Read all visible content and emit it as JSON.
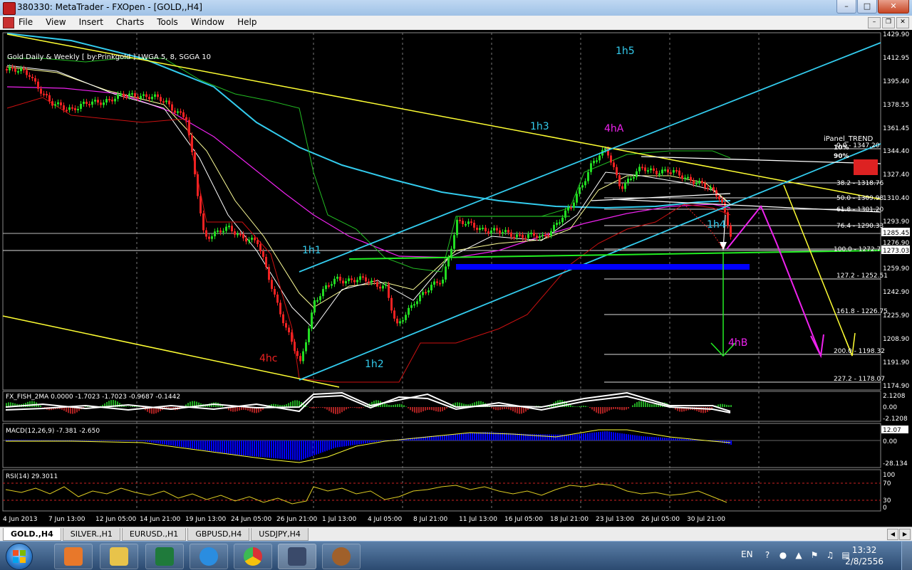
{
  "window": {
    "title": "380330: MetaTrader - FXOpen - [GOLD,,H4]"
  },
  "menu": {
    "items": [
      "File",
      "View",
      "Insert",
      "Charts",
      "Tools",
      "Window",
      "Help"
    ]
  },
  "chart": {
    "header": "Gold Daily & Weekly [ by:Prinkgold ] LWGA 5, 8, SGGA 10",
    "fish_label": "FX_FISH_2MA 0.0000 -1.7023 -1.7023 -0.9687 -0.1442",
    "macd_label": "MACD(12,26,9) -7.381 -2.650",
    "rsi_label": "RSI(14) 29.3011",
    "ipanel": "iPanel_TREND",
    "ipanel_rows": [
      "10%",
      "90%"
    ],
    "annotations": {
      "h1h1": "1h1",
      "h1h2": "1h2",
      "h1h3": "1h3",
      "h1h4": "1h4",
      "h1h5": "1h5",
      "h4a": "4hA",
      "h4b": "4hB",
      "h4c": "4hc"
    },
    "price_axis": [
      "1429.90",
      "1412.95",
      "1395.40",
      "1378.55",
      "1361.45",
      "1344.40",
      "1327.40",
      "1310.40",
      "1293.90",
      "1276.90",
      "1259.90",
      "1242.90",
      "1225.90",
      "1208.90",
      "1191.90",
      "1174.90"
    ],
    "price_tags": {
      "bid": "1285.45",
      "line": "1273.03"
    },
    "fib_labels": [
      "0.0 - 1347.20",
      "38.2 - 1318.76",
      "50.0 - 1309.98",
      "61.8 - 1301.20",
      "76.4 - 1290.33",
      "100.0 - 1272.76",
      "127.2 - 1252.51",
      "161.8 - 1226.75",
      "200.0 - 1198.32",
      "227.2 - 1178.07"
    ],
    "fish_axis": [
      "2.1208",
      "0.00",
      "-2.1208"
    ],
    "macd_axis": [
      "12.07",
      "0.00",
      "-28.134"
    ],
    "rsi_axis": [
      "100",
      "70",
      "30",
      "0"
    ],
    "time_axis": [
      "4 Jun 2013",
      "7 Jun 13:00",
      "12 Jun 05:00",
      "14 Jun 21:00",
      "19 Jun 13:00",
      "24 Jun 05:00",
      "26 Jun 21:00",
      "1 Jul 13:00",
      "4 Jul 05:00",
      "8 Jul 21:00",
      "11 Jul 13:00",
      "16 Jul 05:00",
      "18 Jul 21:00",
      "23 Jul 13:00",
      "26 Jul 05:00",
      "30 Jul 21:00"
    ],
    "colors": {
      "bull": "#22dd22",
      "bear": "#ee2222",
      "yellow": "#ffff33",
      "cyan": "#33ccee",
      "magenta": "#ee22ee",
      "blue": "#0000ff"
    }
  },
  "tabs": [
    "GOLD.,H4",
    "SILVER.,H1",
    "EURUSD.,H1",
    "GBPUSD,H4",
    "USDJPY,H4"
  ],
  "taskbar": {
    "lang": "EN",
    "time": "13:32",
    "date": "2/8/2556"
  }
}
